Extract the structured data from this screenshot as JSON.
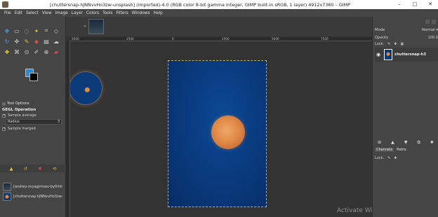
{
  "window": {
    "title": "[chuttersnap-hJNNvvHo3zw-unsplash] (imported)-4.0 (RGB color 8-bit gamma integer, GIMP built-in sRGB, 1 layer) 4912x7360 – GIMP",
    "minimize": "–",
    "maximize": "□",
    "close": "✕"
  },
  "menu": [
    "File",
    "Edit",
    "Select",
    "View",
    "Image",
    "Layer",
    "Colors",
    "Tools",
    "Filters",
    "Windows",
    "Help"
  ],
  "toolbox": {
    "icons": [
      "move-icon",
      "rect-select-icon",
      "lasso-icon",
      "fuzzy-select-icon",
      "crop-icon",
      "unified-transform-icon",
      "warp-icon",
      "handle-transform-icon",
      "paint-icon",
      "bucket-fill-icon",
      "gradient-icon",
      "smudge-icon",
      "text-icon",
      "paths-icon",
      "clone-icon",
      "color-picker-icon",
      "zoom-icon",
      "eraser-icon"
    ],
    "fg_color": "#1d8fe0",
    "bg_color": "#000000"
  },
  "tool_options": {
    "tab_label": "Tool Options",
    "operation": "GEGL Operation",
    "sample_average": "Sample average",
    "radius_label": "Radius",
    "radius_value": "3",
    "sample_merged": "Sample merged"
  },
  "images_panel": {
    "items": [
      "[andrey-zvyagintsev-byfhhh",
      "[chuttersnap-hJNNvvHo3zw-"
    ]
  },
  "ruler": {
    "top_ticks": [
      "5000",
      "2500",
      "0",
      "2500",
      "5000",
      "7500"
    ]
  },
  "layers": {
    "mode_label": "Mode",
    "mode_value": "Normal",
    "opacity_label": "Opacity",
    "opacity_value": "100.0",
    "lock_label": "Lock:",
    "layer_name": "chuttersnap-h3"
  },
  "channels": {
    "tab_channels": "Channels",
    "tab_paths": "Paths",
    "lock_label": "Lock:"
  },
  "watermark": "Activate Windows"
}
